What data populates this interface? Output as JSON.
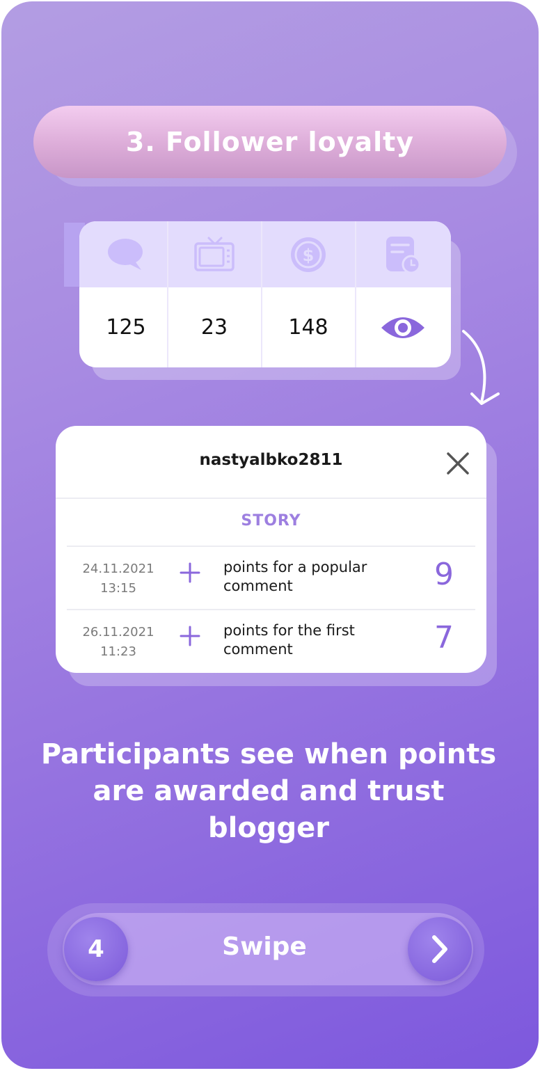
{
  "step_title": "3. Follower loyalty",
  "stats": {
    "columns": [
      {
        "icon": "comment-bubble-icon",
        "value": "125"
      },
      {
        "icon": "tv-icon",
        "value": "23"
      },
      {
        "icon": "coin-icon",
        "value": "148"
      },
      {
        "icon": "history-icon",
        "action_icon": "eye-icon"
      }
    ]
  },
  "history": {
    "username": "nastyalbko2811",
    "section_label": "STORY",
    "rows": [
      {
        "date": "24.11.2021",
        "time": "13:15",
        "description": "points for a popular comment",
        "points": "9"
      },
      {
        "date": "26.11.2021",
        "time": "11:23",
        "description": "points for the first comment",
        "points": "7"
      }
    ]
  },
  "caption": "Participants see when points are awarded and trust blogger",
  "footer": {
    "page_number": "4",
    "swipe_label": "Swipe"
  },
  "colors": {
    "accent": "#8a67dc",
    "story": "#9d7fe0",
    "header_tint": "#e3dcfd"
  }
}
